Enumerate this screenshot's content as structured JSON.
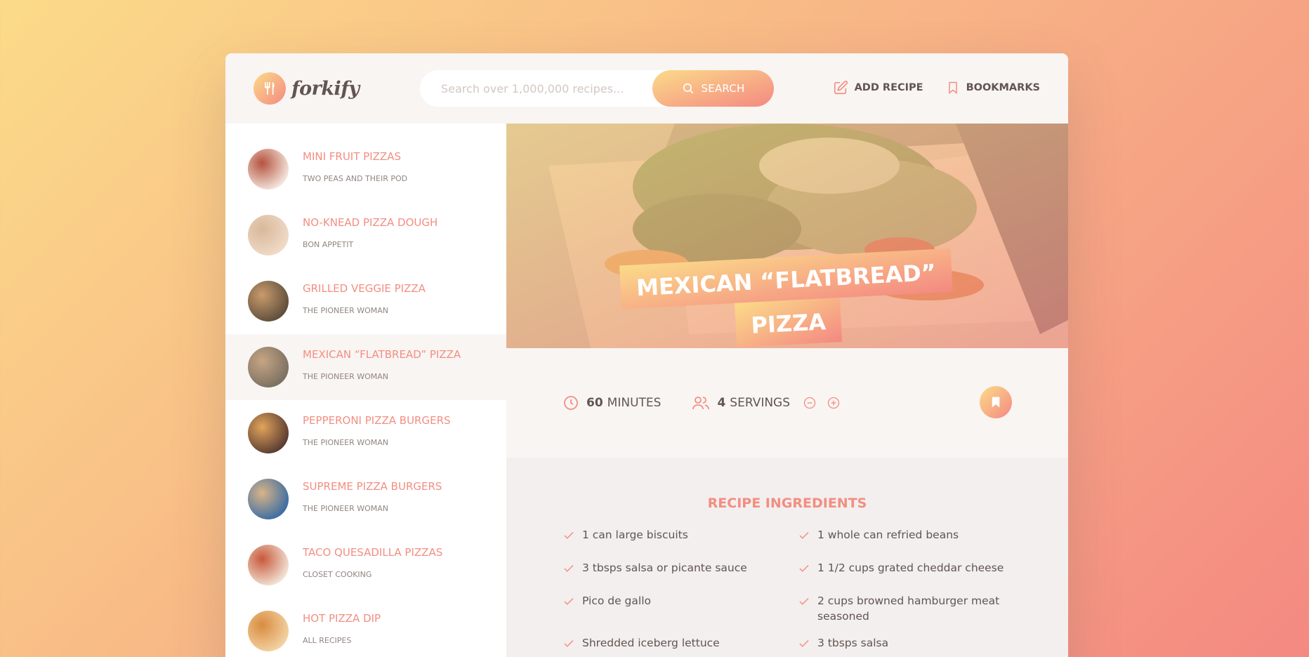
{
  "app": {
    "name": "forkify"
  },
  "search": {
    "placeholder": "Search over 1,000,000 recipes...",
    "button_label": "SEARCH"
  },
  "nav": {
    "add_recipe": "ADD RECIPE",
    "bookmarks": "BOOKMARKS"
  },
  "results": [
    {
      "title": "MINI FRUIT PIZZAS",
      "publisher": "TWO PEAS AND THEIR POD",
      "active": false,
      "thumb_colors": [
        "#f4e5dc",
        "#b5533f"
      ]
    },
    {
      "title": "NO-KNEAD PIZZA DOUGH",
      "publisher": "BON APPETIT",
      "active": false,
      "thumb_colors": [
        "#f0dac7",
        "#d8b89a"
      ]
    },
    {
      "title": "GRILLED VEGGIE PIZZA",
      "publisher": "THE PIONEER WOMAN",
      "active": false,
      "thumb_colors": [
        "#5f4e3c",
        "#c99b6c"
      ]
    },
    {
      "title": "MEXICAN “FLATBREAD” PIZZA",
      "publisher": "THE PIONEER WOMAN",
      "active": true,
      "thumb_colors": [
        "#7b7062",
        "#c7a584"
      ]
    },
    {
      "title": "PEPPERONI PIZZA BURGERS",
      "publisher": "THE PIONEER WOMAN",
      "active": false,
      "thumb_colors": [
        "#5a3c33",
        "#e1a45a"
      ]
    },
    {
      "title": "SUPREME PIZZA BURGERS",
      "publisher": "THE PIONEER WOMAN",
      "active": false,
      "thumb_colors": [
        "#3c6da3",
        "#d9b487"
      ]
    },
    {
      "title": "TACO QUESADILLA PIZZAS",
      "publisher": "CLOSET COOKING",
      "active": false,
      "thumb_colors": [
        "#f1e3d4",
        "#c8583a"
      ]
    },
    {
      "title": "HOT PIZZA DIP",
      "publisher": "ALL RECIPES",
      "active": false,
      "thumb_colors": [
        "#f3d2a3",
        "#d98c3f"
      ]
    }
  ],
  "recipe": {
    "title_line1": "MEXICAN “FLATBREAD”",
    "title_line2": "PIZZA",
    "cooking_time": "60",
    "cooking_time_unit": "MINUTES",
    "servings": "4",
    "servings_unit": "SERVINGS",
    "ingredients_heading": "RECIPE INGREDIENTS",
    "ingredients": [
      "1 can large biscuits",
      "1 whole can refried beans",
      "3 tbsps salsa or picante sauce",
      "1 1/2 cups grated cheddar cheese",
      " Pico de gallo",
      "2 cups browned hamburger meat seasoned",
      " Shredded iceberg lettuce",
      "3 tbsps salsa"
    ]
  },
  "colors": {
    "accent": "#f38e82",
    "grad_start": "#fbdb89",
    "grad_end": "#f48982",
    "text": "#615551"
  }
}
